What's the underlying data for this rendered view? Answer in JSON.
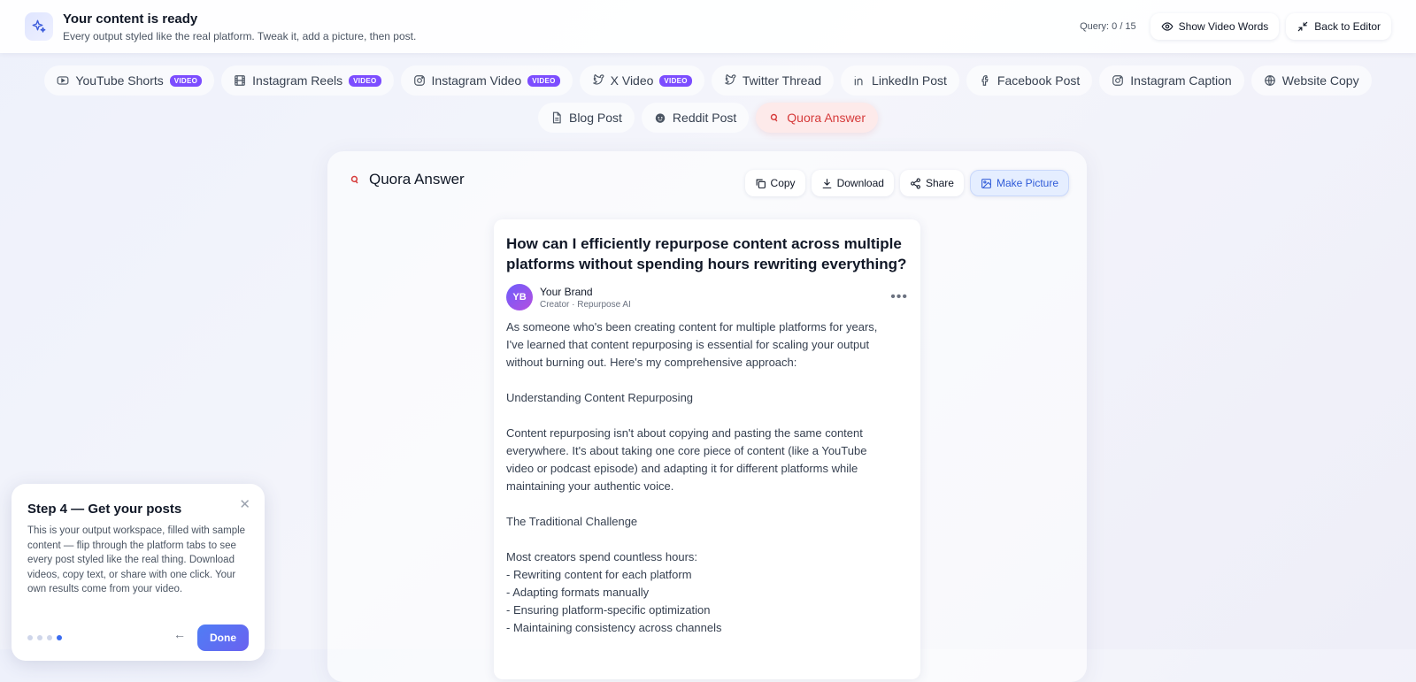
{
  "header": {
    "title": "Your content is ready",
    "subtitle": "Every output styled like the real platform. Tweak it, add a picture, then post.",
    "query": "Query: 0 / 15",
    "show_words": "Show Video Words",
    "back_editor": "Back to Editor"
  },
  "tabs_row1": [
    {
      "label": "YouTube Shorts",
      "badge": "VIDEO"
    },
    {
      "label": "Instagram Reels",
      "badge": "VIDEO"
    },
    {
      "label": "Instagram Video",
      "badge": "VIDEO"
    },
    {
      "label": "X Video",
      "badge": "VIDEO"
    },
    {
      "label": "Twitter Thread"
    },
    {
      "label": "LinkedIn Post"
    },
    {
      "label": "Facebook Post"
    },
    {
      "label": "Instagram Caption"
    },
    {
      "label": "Website Copy"
    }
  ],
  "tabs_row2": [
    {
      "label": "Blog Post"
    },
    {
      "label": "Reddit Post"
    },
    {
      "label": "Quora Answer",
      "active": true
    }
  ],
  "panel": {
    "title": "Quora Answer",
    "copy": "Copy",
    "download": "Download",
    "share": "Share",
    "make_picture": "Make Picture"
  },
  "card": {
    "question": "How can I efficiently repurpose content across multiple platforms without spending hours rewriting everything?",
    "avatar": "YB",
    "author": "Your Brand",
    "author_meta": "Creator · Repurpose AI",
    "lines": [
      "As someone who's been creating content for multiple platforms for years,",
      "I've learned that content repurposing is essential for scaling your output",
      "without burning out. Here's my comprehensive approach:",
      "",
      "Understanding Content Repurposing",
      "",
      "Content repurposing isn't about copying and pasting the same content",
      "everywhere. It's about taking one core piece of content (like a YouTube",
      "video or podcast episode) and adapting it for different platforms while",
      "maintaining your authentic voice.",
      "",
      "The Traditional Challenge",
      "",
      "Most creators spend countless hours:",
      "- Rewriting content for each platform",
      "- Adapting formats manually",
      "- Ensuring platform-specific optimization",
      "- Maintaining consistency across channels"
    ]
  },
  "tour": {
    "title": "Step 4 — Get your posts",
    "body": "This is your output workspace, filled with sample content — flip through the platform tabs to see every post styled like the real thing. Download videos, copy text, or share with one click. Your own results come from your video.",
    "done": "Done",
    "steps_total": 4,
    "step_current": 4
  },
  "colors": {
    "accent": "#3b6cf0",
    "quora": "#d63b3b",
    "badge": "#7c4dff"
  }
}
